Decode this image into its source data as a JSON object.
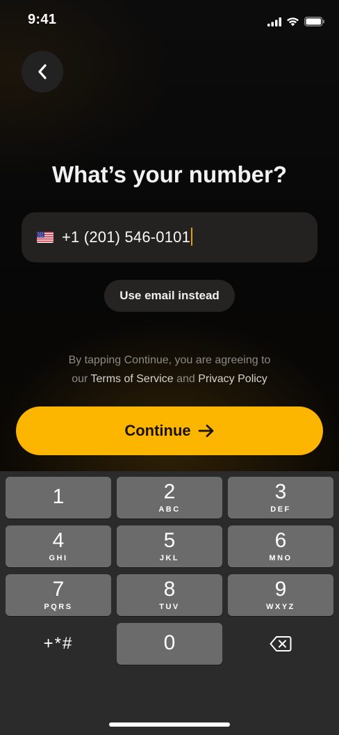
{
  "status_bar": {
    "time": "9:41",
    "icons": [
      "cellular-signal-icon",
      "wifi-icon",
      "battery-icon"
    ]
  },
  "back_button": {
    "icon": "chevron-left-icon"
  },
  "title": "What’s your number?",
  "phone_input": {
    "flag_icon": "us-flag-icon",
    "value": "+1 (201) 546-0101"
  },
  "email_button": {
    "label": "Use email instead"
  },
  "terms": {
    "prefix": "By tapping Continue, you are agreeing to",
    "our": "our",
    "terms_link": "Terms of Service",
    "and": "and",
    "privacy_link": "Privacy Policy"
  },
  "continue_button": {
    "label": "Continue",
    "icon": "arrow-right-icon"
  },
  "colors": {
    "accent": "#fdb600",
    "caret": "#e6a100",
    "key_background": "#6b6b6b",
    "keypad_background": "#2b2b2b"
  },
  "keypad": {
    "keys": [
      {
        "digit": "1",
        "letters": ""
      },
      {
        "digit": "2",
        "letters": "ABC"
      },
      {
        "digit": "3",
        "letters": "DEF"
      },
      {
        "digit": "4",
        "letters": "GHI"
      },
      {
        "digit": "5",
        "letters": "JKL"
      },
      {
        "digit": "6",
        "letters": "MNO"
      },
      {
        "digit": "7",
        "letters": "PQRS"
      },
      {
        "digit": "8",
        "letters": "TUV"
      },
      {
        "digit": "9",
        "letters": "WXYZ"
      },
      {
        "digit": "0",
        "letters": ""
      }
    ],
    "symbols_label": "+*#",
    "delete_icon": "backspace-icon"
  }
}
